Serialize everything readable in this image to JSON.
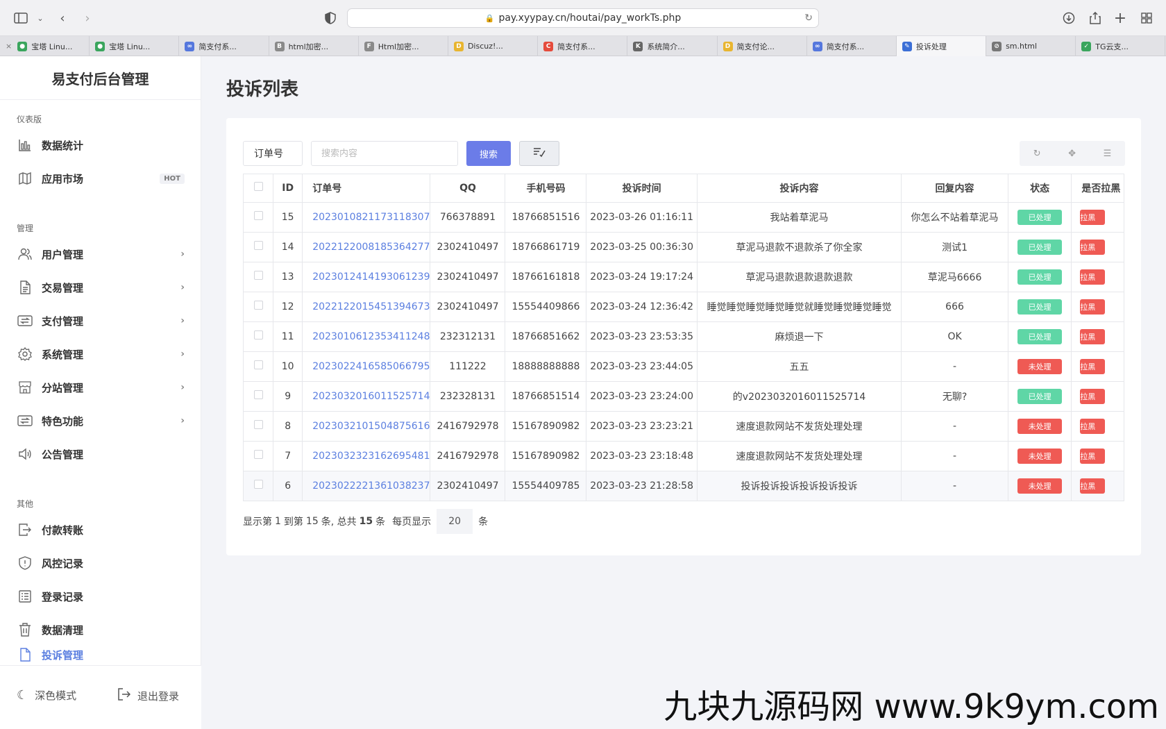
{
  "browser": {
    "url": "pay.xyypay.cn/houtai/pay_workTs.php",
    "tabs": [
      {
        "label": "宝塔 Linu...",
        "color": "#3aa55d",
        "glyph": "●"
      },
      {
        "label": "宝塔 Linu...",
        "color": "#3aa55d",
        "glyph": "●"
      },
      {
        "label": "简支付系...",
        "color": "#5577dd",
        "glyph": "∞"
      },
      {
        "label": "html加密...",
        "color": "#8a8a8a",
        "glyph": "B"
      },
      {
        "label": "Html加密...",
        "color": "#8a8a8a",
        "glyph": "F"
      },
      {
        "label": "Discuz!...",
        "color": "#e8b530",
        "glyph": "D"
      },
      {
        "label": "简支付系...",
        "color": "#e54b3c",
        "glyph": "C"
      },
      {
        "label": "系统简介...",
        "color": "#666666",
        "glyph": "K"
      },
      {
        "label": "简支付论...",
        "color": "#e8b530",
        "glyph": "D"
      },
      {
        "label": "简支付系...",
        "color": "#5577dd",
        "glyph": "∞"
      },
      {
        "label": "投诉处理",
        "color": "#3b6fd6",
        "glyph": "✎"
      },
      {
        "label": "sm.html",
        "color": "#777777",
        "glyph": "⊘"
      },
      {
        "label": "TG云支...",
        "color": "#3aa55d",
        "glyph": "✓"
      }
    ]
  },
  "sidebar": {
    "brand": "易支付后台管理",
    "sections": {
      "dashboard": "仪表版",
      "manage": "管理",
      "other": "其他"
    },
    "items": {
      "stats": "数据统计",
      "market": "应用市场",
      "market_badge": "HOT",
      "users": "用户管理",
      "trades": "交易管理",
      "payments": "支付管理",
      "system": "系统管理",
      "substation": "分站管理",
      "features": "特色功能",
      "notices": "公告管理",
      "transfer": "付款转账",
      "risk": "风控记录",
      "login": "登录记录",
      "cleanup": "数据清理",
      "complaints": "投诉管理"
    },
    "dark_mode": "深色模式",
    "logout": "退出登录"
  },
  "main": {
    "title": "投诉列表",
    "filter_select": "订单号",
    "search_placeholder": "搜索内容",
    "search_button": "搜索"
  },
  "table": {
    "headers": {
      "id": "ID",
      "order": "订单号",
      "qq": "QQ",
      "phone": "手机号码",
      "time": "投诉时间",
      "content": "投诉内容",
      "reply": "回复内容",
      "status": "状态",
      "extra": "是否拉黑"
    },
    "extra_badge": "拉黑",
    "rows": [
      {
        "id": "15",
        "order": "2023010821173118307",
        "qq": "766378891",
        "phone": "18766851516",
        "time": "2023-03-26 01:16:11",
        "content": "我站着草泥马",
        "reply": "你怎么不站着草泥马",
        "status": "已处理",
        "done": true
      },
      {
        "id": "14",
        "order": "2022122008185364277",
        "qq": "2302410497",
        "phone": "18766861719",
        "time": "2023-03-25 00:36:30",
        "content": "草泥马退款不退款杀了你全家",
        "reply": "测试1",
        "status": "已处理",
        "done": true
      },
      {
        "id": "13",
        "order": "2023012414193061239",
        "qq": "2302410497",
        "phone": "18766161818",
        "time": "2023-03-24 19:17:24",
        "content": "草泥马退款退款退款退款",
        "reply": "草泥马6666",
        "status": "已处理",
        "done": true
      },
      {
        "id": "12",
        "order": "2022122015451394673",
        "qq": "2302410497",
        "phone": "15554409866",
        "time": "2023-03-24 12:36:42",
        "content": "睡觉睡觉睡觉睡觉睡觉就睡觉睡觉睡觉睡觉",
        "reply": "666",
        "status": "已处理",
        "done": true
      },
      {
        "id": "11",
        "order": "2023010612353411248",
        "qq": "232312131",
        "phone": "18766851662",
        "time": "2023-03-23 23:53:35",
        "content": "麻烦退一下",
        "reply": "OK",
        "status": "已处理",
        "done": true
      },
      {
        "id": "10",
        "order": "2023022416585066795",
        "qq": "111222",
        "phone": "18888888888",
        "time": "2023-03-23 23:44:05",
        "content": "五五",
        "reply": "-",
        "status": "未处理",
        "done": false
      },
      {
        "id": "9",
        "order": "2023032016011525714",
        "qq": "232328131",
        "phone": "18766851514",
        "time": "2023-03-23 23:24:00",
        "content": "的v2023032016011525714",
        "reply": "无聊?",
        "status": "已处理",
        "done": true
      },
      {
        "id": "8",
        "order": "2023032101504875616",
        "qq": "2416792978",
        "phone": "15167890982",
        "time": "2023-03-23 23:23:21",
        "content": "速度退款网站不发货处理处理",
        "reply": "-",
        "status": "未处理",
        "done": false
      },
      {
        "id": "7",
        "order": "2023032323162695481",
        "qq": "2416792978",
        "phone": "15167890982",
        "time": "2023-03-23 23:18:48",
        "content": "速度退款网站不发货处理处理",
        "reply": "-",
        "status": "未处理",
        "done": false
      },
      {
        "id": "6",
        "order": "2023022221361038237",
        "qq": "2302410497",
        "phone": "15554409785",
        "time": "2023-03-23 21:28:58",
        "content": "投诉投诉投诉投诉投诉投诉",
        "reply": "-",
        "status": "未处理",
        "done": false
      }
    ]
  },
  "pager": {
    "text1": "显示第",
    "from": "1",
    "text2": "到第",
    "to": "15",
    "text3": "条, 总共",
    "total": "15",
    "text4": "条",
    "text5": "每页显示",
    "page_size": "20",
    "text6": "条"
  },
  "watermark": "九块九源码网 www.9k9ym.com",
  "colors": {
    "accent": "#6b7ce8",
    "done": "#5fd6a6",
    "todo": "#ef5a54",
    "link": "#5b7fe0"
  }
}
